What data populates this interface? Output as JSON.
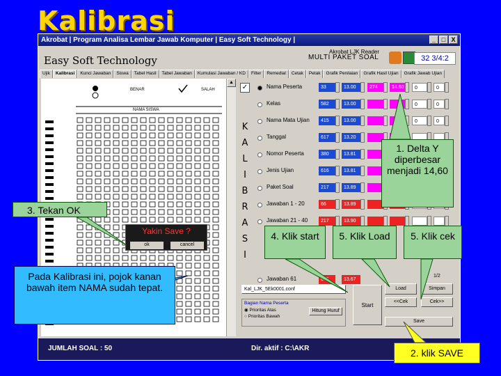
{
  "slide_title": "Kalibrasi",
  "window": {
    "title": "Akrobat | Program Analisa Lembar Jawab Komputer | Easy Soft Technology |",
    "controls": [
      "_",
      "□",
      "X"
    ],
    "brand": "Easy Soft Technology",
    "app_name": "Akrobat LJK Reader",
    "multi_label": "MULTI PAKET SOAL",
    "code": "32 3/4:2"
  },
  "tabs": [
    "Ujik",
    "Kalibrasi",
    "Kunci Jawaban",
    "Siswa",
    "Tabel Hasil",
    "Tabel Jawaban",
    "Kumulasi Jawaban / KD",
    "Filter",
    "Remedial",
    "Cetak",
    "Petak",
    "Grafik Penilaian",
    "Grafik Hasil Ujian",
    "Grafik Jawab Ujian"
  ],
  "sheet": {
    "benar": "BENAR",
    "salah": "SALAH",
    "nama_siswa": "NAMA SISWA"
  },
  "kalibrasi_vertical": "KALIBRASI",
  "rows": [
    {
      "label": "Nama Peserta",
      "checked": true,
      "selected": true,
      "v1": "33",
      "v2": "13.00",
      "v3": "274",
      "v4": "14.60",
      "v5": "0",
      "v6": "0",
      "c1": "#1a4ad8",
      "c2": "#1a4ad8",
      "c3": "#ff00ff",
      "c4": "#ff00ff"
    },
    {
      "label": "Kelas",
      "checked": false,
      "selected": false,
      "v1": "582",
      "v2": "13.00",
      "v3": "",
      "v4": "",
      "v5": "0",
      "v6": "0",
      "c1": "#1a4ad8",
      "c2": "#1a4ad8",
      "c3": "#ff00ff",
      "c4": "#ff00ff"
    },
    {
      "label": "Nama Mata Ujian",
      "checked": false,
      "selected": false,
      "v1": "415",
      "v2": "13.00",
      "v3": "",
      "v4": "",
      "v5": "0",
      "v6": "0",
      "c1": "#1a4ad8",
      "c2": "#1a4ad8",
      "c3": "#ff00ff",
      "c4": "#ff00ff"
    },
    {
      "label": "Tanggal",
      "checked": false,
      "selected": false,
      "v1": "617",
      "v2": "13.20",
      "v3": "",
      "v4": "",
      "v5": "",
      "v6": "",
      "c1": "#1a4ad8",
      "c2": "#1a4ad8",
      "c3": "#ff00ff",
      "c4": "#ff00ff"
    },
    {
      "label": "Nomor Peserta",
      "checked": false,
      "selected": false,
      "v1": "380",
      "v2": "13.81",
      "v3": "",
      "v4": "",
      "v5": "",
      "v6": "",
      "c1": "#1a4ad8",
      "c2": "#1a4ad8",
      "c3": "#ff00ff",
      "c4": "#ff00ff"
    },
    {
      "label": "Jenis Ujian",
      "checked": false,
      "selected": false,
      "v1": "616",
      "v2": "13.81",
      "v3": "",
      "v4": "",
      "v5": "",
      "v6": "",
      "c1": "#1a4ad8",
      "c2": "#1a4ad8",
      "c3": "#ff00ff",
      "c4": "#ff00ff"
    },
    {
      "label": "Paket Soal",
      "checked": false,
      "selected": false,
      "v1": "217",
      "v2": "13.89",
      "v3": "",
      "v4": "",
      "v5": "",
      "v6": "",
      "c1": "#1a4ad8",
      "c2": "#1a4ad8",
      "c3": "#ff00ff",
      "c4": "#ff00ff"
    },
    {
      "label": "Jawaban 1 - 20",
      "checked": false,
      "selected": false,
      "v1": "66",
      "v2": "13.89",
      "v3": "",
      "v4": "",
      "v5": "",
      "v6": "",
      "c1": "#ee2222",
      "c2": "#ee2222",
      "c3": "#ee2222",
      "c4": "#ee2222"
    },
    {
      "label": "Jawaban 21 - 40",
      "checked": false,
      "selected": false,
      "v1": "217",
      "v2": "13.90",
      "v3": "",
      "v4": "",
      "v5": "",
      "v6": "",
      "c1": "#ee2222",
      "c2": "#ee2222",
      "c3": "#ee2222",
      "c4": "#ee2222"
    }
  ],
  "last_row": {
    "label": "Jawaban 61",
    "v1": "665",
    "v2": "13.67"
  },
  "panel": {
    "file": "Kal_LJK_5Ek0001.conf",
    "group_label": "Bagian Nama Peserta",
    "opt1": "Prioritas Atas",
    "opt2": "Prioritas Bawah",
    "btn_hitung": "Hitung Huruf",
    "start": "Start",
    "load": "Load",
    "simpan": "Simpan",
    "prev": "<<Cek",
    "next": "Cek>>",
    "save": "Save",
    "num": "1/2"
  },
  "status": {
    "jumlah": "JUMLAH SOAL : 50",
    "direktori": "Dir. aktif : C:\\AKR"
  },
  "dialog": {
    "title": "Yakin Save ?",
    "ok": "ok",
    "cancel": "cancel"
  },
  "callouts": {
    "delta": "1. Delta Y diperbesar menjadi 14,60",
    "ok": "3. Tekan OK",
    "start": "4. Klik start",
    "load": "5. Klik Load",
    "cek": "5. Klik cek",
    "note": "Pada Kalibrasi ini, pojok kanan bawah item NAMA sudah tepat.",
    "save": "2. klik SAVE"
  }
}
